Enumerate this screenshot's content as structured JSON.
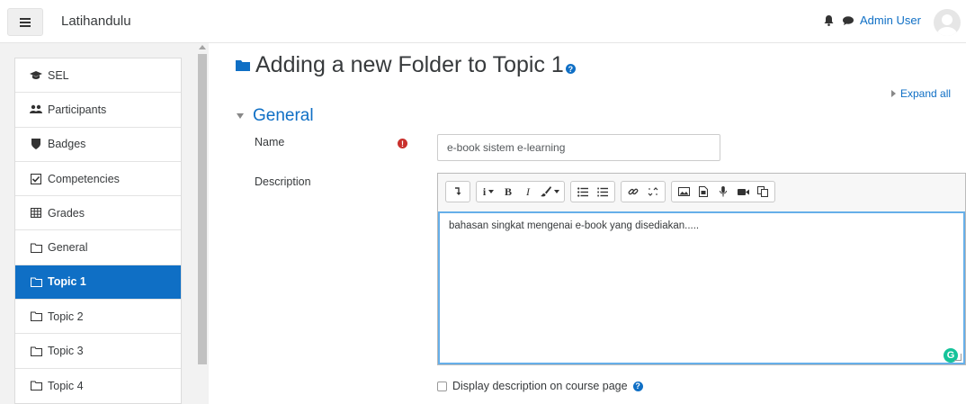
{
  "navbar": {
    "menu_icon": "hamburger-icon",
    "site_name": "Latihandulu",
    "notifications_icon": "bell-icon",
    "messages_icon": "chat-icon",
    "user_name": "Admin User"
  },
  "sidebar": {
    "items": [
      {
        "label": "SEL",
        "icon": "graduation-cap-icon",
        "active": false
      },
      {
        "label": "Participants",
        "icon": "users-icon",
        "active": false
      },
      {
        "label": "Badges",
        "icon": "shield-icon",
        "active": false
      },
      {
        "label": "Competencies",
        "icon": "check-square-icon",
        "active": false
      },
      {
        "label": "Grades",
        "icon": "table-icon",
        "active": false
      },
      {
        "label": "General",
        "icon": "folder-icon",
        "active": false
      },
      {
        "label": "Topic 1",
        "icon": "folder-icon",
        "active": true
      },
      {
        "label": "Topic 2",
        "icon": "folder-icon",
        "active": false
      },
      {
        "label": "Topic 3",
        "icon": "folder-icon",
        "active": false
      },
      {
        "label": "Topic 4",
        "icon": "folder-icon",
        "active": false
      }
    ]
  },
  "main": {
    "title": "Adding a new Folder to Topic 1",
    "help_glyph": "?",
    "expand_all": "Expand all",
    "section_title": "General",
    "name_label": "Name",
    "required_glyph": "!",
    "name_value": "e-book sistem e-learning",
    "description_label": "Description",
    "toolbar": {
      "bold": "B",
      "italic": "I",
      "info": "i"
    },
    "description_text": "bahasan singkat mengenai e-book yang disediakan.....",
    "grammarly_glyph": "G",
    "display_description_label": "Display description on course page"
  },
  "colors": {
    "brand": "#0f6fc5",
    "required": "#c9302c",
    "focus_border": "#66afe9"
  }
}
